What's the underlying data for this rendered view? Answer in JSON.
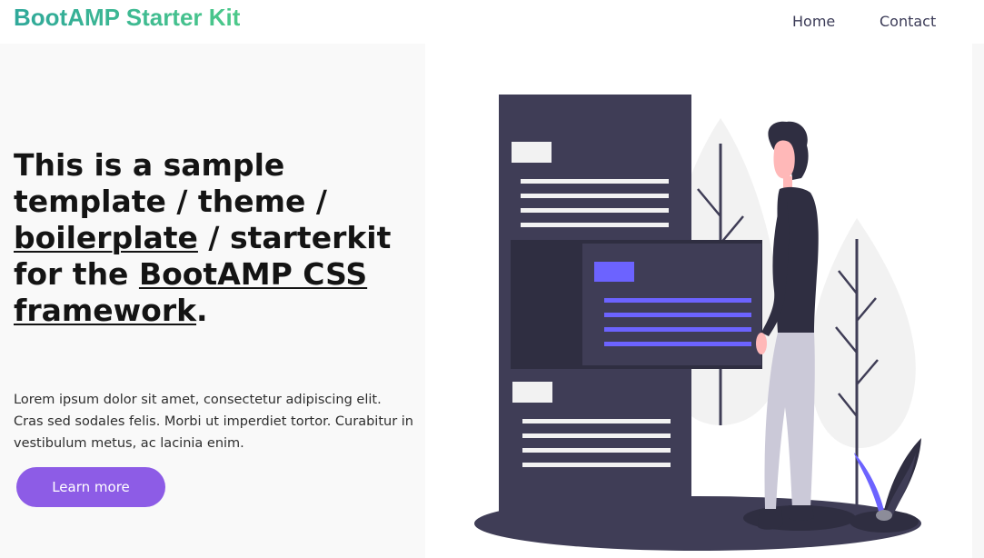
{
  "navbar": {
    "brand": "BootAMP Starter Kit",
    "links": [
      {
        "label": "Home"
      },
      {
        "label": "Contact"
      }
    ]
  },
  "hero": {
    "headline": {
      "part1": "This is a sample template / theme / ",
      "link1": "boilerplate",
      "part2": " / starterkit for the ",
      "link2": "BootAMP CSS framework",
      "part3": "."
    },
    "lead": "Lorem ipsum dolor sit amet, consectetur adipiscing elit. Cras sed sodales felis. Morbi ut imperdiet tortor. Curabitur in vestibulum metus, ac lacinia enim.",
    "cta_label": "Learn more"
  },
  "colors": {
    "brand_gradient_start": "#2fa89a",
    "brand_gradient_end": "#4cc98a",
    "cta": "#8d5ce6",
    "hero_left_bg": "#f9f9f9",
    "illustration_dark": "#3f3d56",
    "illustration_accent": "#6c63ff"
  },
  "illustration": {
    "name": "person-with-documents-illustration"
  }
}
